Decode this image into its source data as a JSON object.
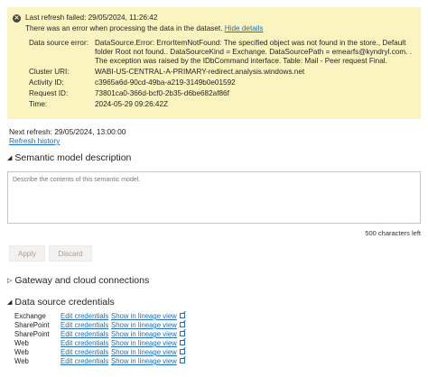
{
  "banner": {
    "status_line": "Last refresh failed: 29/05/2024, 11:26:42",
    "message": "There was an error when processing the data in the dataset.",
    "hide_details": "Hide details",
    "details": [
      {
        "label": "Data source error:",
        "value": "DataSource.Error: ErrorItemNotFound: The specified object was not found in the store., Default folder Root not found.. DataSourceKind = Exchange. DataSourcePath = emearfs@kyndryl.com. . The exception was raised by the IDbCommand interface. Table: Mail - Peer request Final."
      },
      {
        "label": "Cluster URI:",
        "value": "WABI-US-CENTRAL-A-PRIMARY-redirect.analysis.windows.net"
      },
      {
        "label": "Activity ID:",
        "value": "c3965a6d-90cd-49ba-a219-3149b0e01592"
      },
      {
        "label": "Request ID:",
        "value": "73801ca0-366d-bcf0-2b35-d6be682af86f"
      },
      {
        "label": "Time:",
        "value": "2024-05-29 09:26:42Z"
      }
    ]
  },
  "next_refresh": "Next refresh: 29/05/2024, 13:00:00",
  "refresh_history": "Refresh history",
  "description_section": {
    "title": "Semantic model description",
    "placeholder": "Describe the contents of this semantic model.",
    "char_count": "500 characters left",
    "apply": "Apply",
    "discard": "Discard"
  },
  "gateway_section": {
    "title": "Gateway and cloud connections"
  },
  "credentials_section": {
    "title": "Data source credentials",
    "rows": [
      {
        "source": "Exchange",
        "edit": "Edit credentials",
        "lineage": "Show in lineage view"
      },
      {
        "source": "SharePoint",
        "edit": "Edit credentials",
        "lineage": "Show in lineage view"
      },
      {
        "source": "SharePoint",
        "edit": "Edit credentials",
        "lineage": "Show in lineage view"
      },
      {
        "source": "Web",
        "edit": "Edit credentials",
        "lineage": "Show in lineage view"
      },
      {
        "source": "Web",
        "edit": "Edit credentials",
        "lineage": "Show in lineage view"
      },
      {
        "source": "Web",
        "edit": "Edit credentials",
        "lineage": "Show in lineage view"
      }
    ]
  }
}
